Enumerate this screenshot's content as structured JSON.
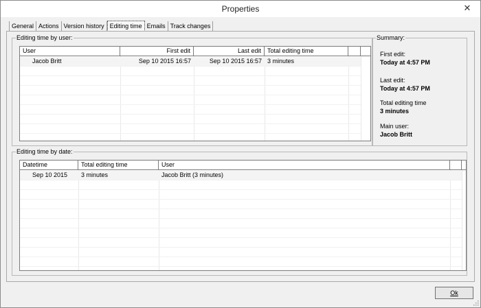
{
  "window": {
    "title": "Properties",
    "close_glyph": "✕"
  },
  "tabs": [
    {
      "label": "General",
      "active": false
    },
    {
      "label": "Actions",
      "active": false
    },
    {
      "label": "Version history",
      "active": false
    },
    {
      "label": "Editing time",
      "active": true
    },
    {
      "label": "Emails",
      "active": false
    },
    {
      "label": "Track changes",
      "active": false
    }
  ],
  "by_user": {
    "group_label": "Editing time by user:",
    "columns": [
      "User",
      "First edit",
      "Last edit",
      "Total editing time"
    ],
    "rows": [
      {
        "user": "Jacob Britt",
        "first_edit": "Sep 10 2015 16:57",
        "last_edit": "Sep 10 2015 16:57",
        "total": "3 minutes"
      }
    ]
  },
  "summary": {
    "group_label": "Summary:",
    "first_edit_label": "First edit:",
    "first_edit_value": "Today at 4:57 PM",
    "last_edit_label": "Last edit:",
    "last_edit_value": "Today at 4:57 PM",
    "total_label": "Total editing time",
    "total_value": "3 minutes",
    "main_user_label": "Main user:",
    "main_user_value": "Jacob Britt"
  },
  "by_date": {
    "group_label": "Editing time by date:",
    "columns": [
      "Datetime",
      "Total editing time",
      "User"
    ],
    "rows": [
      {
        "datetime": "Sep 10 2015",
        "total": "3 minutes",
        "user": "Jacob Britt (3 minutes)"
      }
    ]
  },
  "buttons": {
    "ok_label": "Ok"
  },
  "icons": {
    "close": "close-icon",
    "grip": "resize-grip-icon"
  }
}
